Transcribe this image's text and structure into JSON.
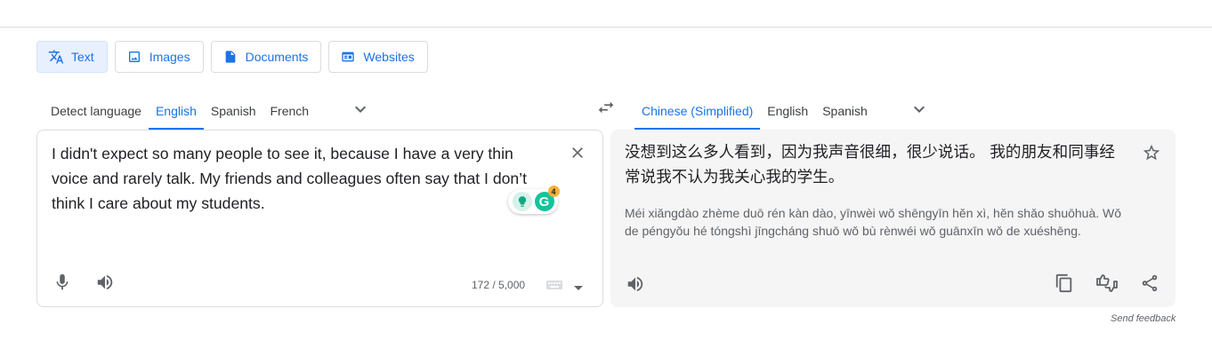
{
  "modes": [
    {
      "label": "Text",
      "icon": "translate-icon",
      "active": true
    },
    {
      "label": "Images",
      "icon": "image-icon"
    },
    {
      "label": "Documents",
      "icon": "document-icon"
    },
    {
      "label": "Websites",
      "icon": "website-icon"
    }
  ],
  "source_langs": [
    "Detect language",
    "English",
    "Spanish",
    "French"
  ],
  "source_active": "English",
  "target_langs": [
    "Chinese (Simplified)",
    "English",
    "Spanish"
  ],
  "target_active": "Chinese (Simplified)",
  "source": {
    "text": "I didn't expect so many people to see it, because I have a very thin voice and rarely talk. My friends and colleagues often say that I don’t think I care about my students.",
    "char_count": "172 / 5,000",
    "grammarly_count": "4"
  },
  "target": {
    "text": "没想到这么多人看到，因为我声音很细，很少说话。 我的朋友和同事经常说我不认为我关心我的学生。",
    "romanization": "Méi xiǎngdào zhème duō rén kàn dào, yīnwèi wǒ shēngyīn hěn xì, hěn shǎo shuōhuà. Wǒ de péngyǒu hé tóngshì jīngcháng shuō wǒ bù rènwéi wǒ guānxīn wǒ de xuéshēng."
  },
  "feedback": "Send feedback",
  "colors": {
    "accent": "#1a73e8",
    "border": "#dadce0",
    "icon": "#5f6368",
    "target_bg": "#f5f5f5"
  }
}
